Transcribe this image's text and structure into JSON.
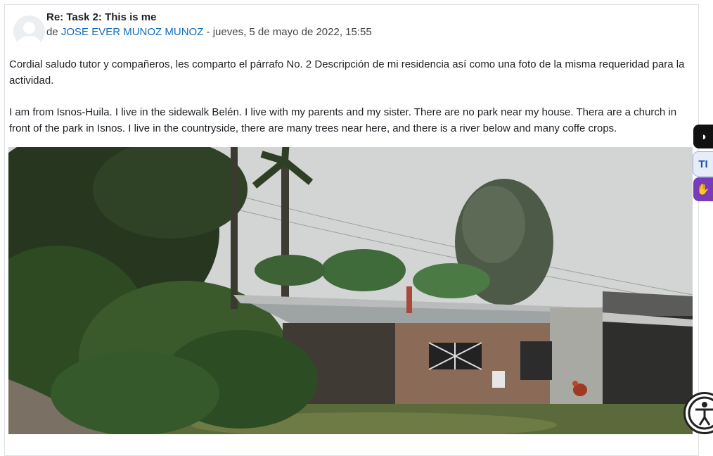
{
  "post": {
    "subject": "Re: Task 2: This is me",
    "by_prefix": "de ",
    "author": "JOSE EVER MUNOZ MUNOZ",
    "date": " - jueves, 5 de mayo de 2022, 15:55",
    "paragraph1": "Cordial saludo tutor y compañeros, les comparto el párrafo No. 2 Descripción de mi residencia así como una foto de la misma requeridad para la actividad.",
    "paragraph2": "I am from Isnos-Huila. I live in the sidewalk Belén. I live with my parents and my sister. There are no park near my house. Thera are a church in front of the park in Isnos. I live in the countryside, there are many trees near here, and there is a river below and many coffe crops."
  },
  "accessibility": {
    "contrast_icon": "contrast-icon",
    "text_label": "TI",
    "sign_icon": "sign-language-icon",
    "fab_icon": "accessibility-icon"
  },
  "colors": {
    "link": "#0f6cbf",
    "contrast_bg": "#111111",
    "sign_bg": "#7a3bb8"
  }
}
